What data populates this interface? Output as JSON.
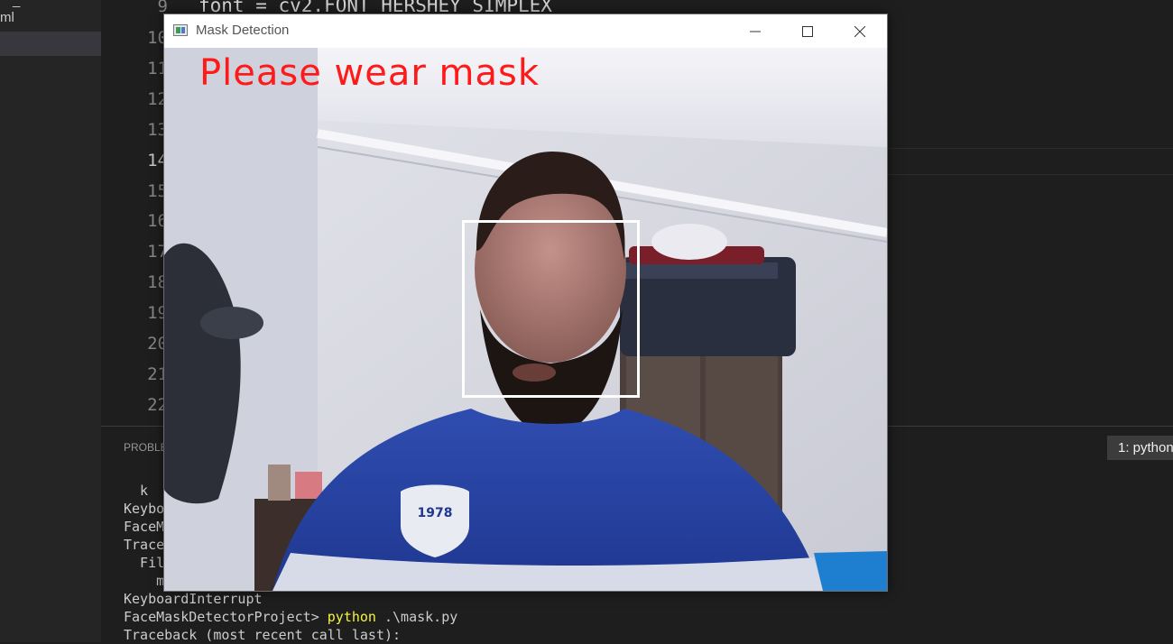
{
  "sidebar": {
    "items": [
      {
        "label": "_"
      },
      {
        "label": "ml"
      }
    ]
  },
  "editor": {
    "line_numbers": [
      "9",
      "10",
      "11",
      "12",
      "13",
      "14",
      "15",
      "16",
      "17",
      "18",
      "19",
      "20",
      "21",
      "22"
    ],
    "active_line": "14",
    "code_line_9": "font = cv2.FONT_HERSHEY_SIMPLEX"
  },
  "panel": {
    "tab_problems": "PROBLEMS",
    "terminal_select": "1: python",
    "terminal_lines": [
      "  k",
      "Keybo",
      "FaceM",
      "Trace",
      "  Fil",
      "    m",
      "KeyboardInterrupt"
    ],
    "prompt": "FaceMaskDetectorProject> ",
    "command": "python",
    "command_args": " .\\mask.py",
    "traceback": "Traceback (most recent call last):"
  },
  "cv_window": {
    "title": "Mask Detection",
    "overlay_text": "Please wear mask",
    "overlay_color": "#ff1a1a",
    "box_color": "#ffffff",
    "shirt_emblem": "1978"
  },
  "window_controls": {
    "minimize_icon": "minimize-icon",
    "maximize_icon": "maximize-icon",
    "close_icon": "close-icon"
  }
}
